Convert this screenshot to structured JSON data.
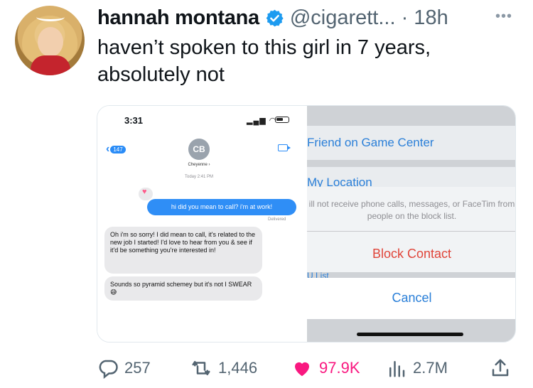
{
  "tweet": {
    "display_name": "hannah montana",
    "handle_time": "@cigarett... · 18h",
    "text": "haven’t spoken to this girl in 7 years, absolutely not"
  },
  "left_screenshot": {
    "time": "3:31",
    "back_count": "147",
    "contact_initials": "CB",
    "contact_name": "Cheyenne ›",
    "date_line": "Today 2:41 PM",
    "outgoing": "hi did you mean to call? i'm at work!",
    "delivered": "Delivered",
    "incoming_1": "Oh i'm so sorry! I did mean to call, it's related to the new job I started! I'd love to hear from you & see if it'd be something you're interested in!",
    "incoming_2": "Sounds so pyramid schemey but it's not I SWEAR 😅"
  },
  "right_screenshot": {
    "friend_row": "Friend on Game Center",
    "my_location": "My Location",
    "block_message": "ill not receive phone calls, messages, or FaceTim from people on the block list.",
    "block_button": "Block Contact",
    "u_list": "U List",
    "cancel_button": "Cancel"
  },
  "actions": {
    "replies": "257",
    "retweets": "1,446",
    "likes": "97.9K",
    "views": "2.7M"
  },
  "colors": {
    "verified": "#1d9bf0",
    "like": "#f91880",
    "ios_blue": "#2a8cf7",
    "block_red": "#e0453a"
  }
}
